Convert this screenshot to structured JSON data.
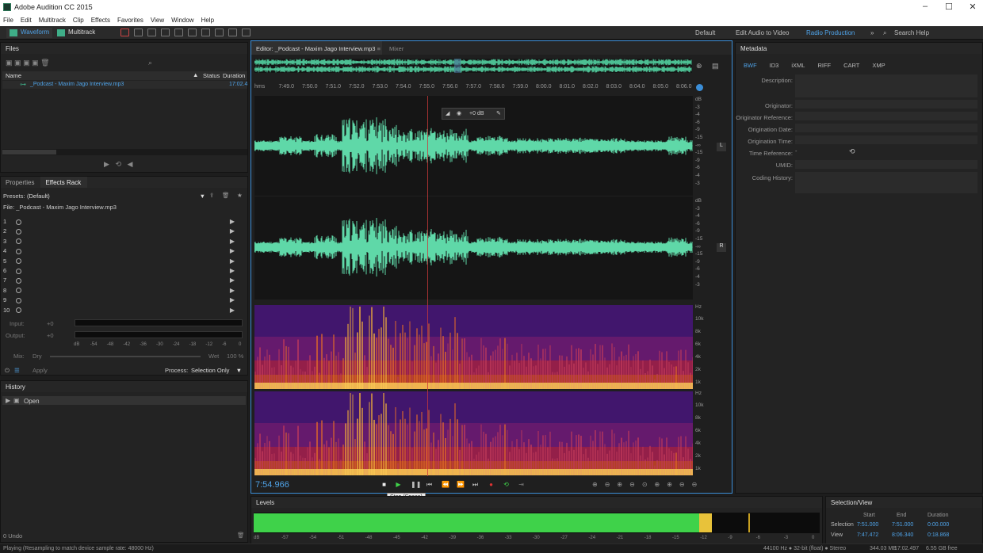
{
  "window": {
    "title": "Adobe Audition CC 2015",
    "min": "–",
    "max": "☐",
    "close": "✕"
  },
  "menu": [
    "File",
    "Edit",
    "Multitrack",
    "Clip",
    "Effects",
    "Favorites",
    "View",
    "Window",
    "Help"
  ],
  "toolbar": {
    "waveform": "Waveform",
    "multitrack": "Multitrack",
    "workspaces": [
      "Default",
      "Edit Audio to Video",
      "Radio Production"
    ],
    "search_help": "Search Help"
  },
  "files": {
    "title": "Files",
    "columns": [
      "Name",
      "Status",
      "Duration"
    ],
    "items": [
      {
        "name": "_Podcast - Maxim Jago Interview.mp3",
        "status": "",
        "duration": "17:02.4"
      }
    ]
  },
  "effects": {
    "tabs": [
      "Properties",
      "Effects Rack"
    ],
    "presets_label": "Presets:",
    "preset_value": "(Default)",
    "file_label": "File: _Podcast - Maxim Jago Interview.mp3",
    "slots": [
      "1",
      "2",
      "3",
      "4",
      "5",
      "6",
      "7",
      "8",
      "9",
      "10"
    ],
    "input_label": "Input:",
    "output_label": "Output:",
    "input_value": "+0",
    "output_value": "+0",
    "meter_scale": [
      "dB",
      "-54",
      "-48",
      "-42",
      "-36",
      "-30",
      "-24",
      "-18",
      "-12",
      "-6",
      "0"
    ],
    "mix_label": "Mix:",
    "dry": "Dry",
    "wet": "Wet",
    "wet_value": "100 %",
    "apply": "Apply",
    "process_label": "Process:",
    "process_value": "Selection Only"
  },
  "history": {
    "title": "History",
    "items": [
      "Open"
    ],
    "undo_count": "0 Undo"
  },
  "editor": {
    "tab_label": "Editor: _Podcast - Maxim Jago Interview.mp3",
    "mixer_tab": "Mixer",
    "time_ticks": [
      "hms",
      "7:49.0",
      "7:50.0",
      "7:51.0",
      "7:52.0",
      "7:53.0",
      "7:54.0",
      "7:55.0",
      "7:56.0",
      "7:57.0",
      "7:58.0",
      "7:59.0",
      "8:00.0",
      "8:01.0",
      "8:02.0",
      "8:03.0",
      "8:04.0",
      "8:05.0",
      "8:06.0"
    ],
    "hud_gain": "+0 dB",
    "db_scale_top": [
      "dB",
      "-3",
      "-4",
      "-6",
      "-9",
      "-15",
      "-∞",
      "-15",
      "-9",
      "-6",
      "-4",
      "-3"
    ],
    "db_scale_bottom": [
      "dB",
      "-3",
      "-4",
      "-6",
      "-9",
      "-15",
      "-∞",
      "-15",
      "-9",
      "-6",
      "-4",
      "-3"
    ],
    "channel_left": "L",
    "channel_right": "R",
    "hz_scale": [
      "Hz",
      "10k",
      "8k",
      "6k",
      "4k",
      "2k",
      "1k"
    ],
    "current_time": "7:54.966",
    "tooltip": "Stop (Space)"
  },
  "metadata": {
    "title": "Metadata",
    "tabs": [
      "BWF",
      "ID3",
      "iXML",
      "RIFF",
      "CART",
      "XMP"
    ],
    "fields": [
      "Description:",
      "Originator:",
      "Originator Reference:",
      "Origination Date:",
      "Origination Time:",
      "Time Reference:",
      "UMID:",
      "Coding History:"
    ],
    "time_reference_value": "-"
  },
  "levels": {
    "title": "Levels",
    "scale": [
      "dB",
      "-57",
      "-54",
      "-51",
      "-48",
      "-45",
      "-42",
      "-39",
      "-36",
      "-33",
      "-30",
      "-27",
      "-24",
      "-21",
      "-18",
      "-15",
      "-12",
      "-9",
      "-6",
      "-3",
      "0"
    ],
    "level_fraction": 0.81
  },
  "selection_view": {
    "title": "Selection/View",
    "headers": [
      "Start",
      "End",
      "Duration"
    ],
    "selection_label": "Selection",
    "view_label": "View",
    "selection": [
      "7:51.000",
      "7:51.000",
      "0:00.000"
    ],
    "view": [
      "7:47.472",
      "8:06.340",
      "0:18.868"
    ]
  },
  "status": {
    "left": "Playing (Resampling to match device sample rate: 48000 Hz)",
    "format": "44100 Hz ● 32-bit (float) ● Stereo",
    "size": "344.03 MB",
    "duration": "17:02.497",
    "free": "6.55 GB free"
  },
  "colors": {
    "accent": "#3b8ed8",
    "waveform": "#5fd8a8",
    "levels_green": "#3fd24a",
    "levels_yellow": "#e8c23a",
    "playhead": "#c83a3a"
  }
}
